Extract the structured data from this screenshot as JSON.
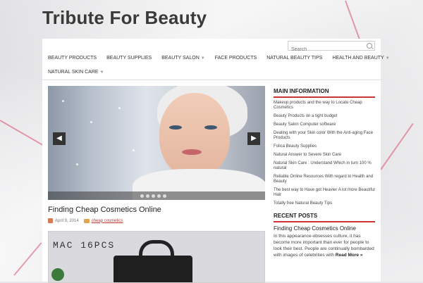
{
  "site": {
    "title": "Tribute For Beauty"
  },
  "search": {
    "placeholder": "Search"
  },
  "nav": {
    "row1": [
      {
        "label": "BEAUTY PRODUCTS",
        "has_submenu": false
      },
      {
        "label": "BEAUTY SUPPLIES",
        "has_submenu": false
      },
      {
        "label": "BEAUTY SALON",
        "has_submenu": true
      },
      {
        "label": "FACE PRODUCTS",
        "has_submenu": false
      },
      {
        "label": "NATURAL BEAUTY TIPS",
        "has_submenu": false
      },
      {
        "label": "HEALTH AND BEAUTY",
        "has_submenu": true
      }
    ],
    "row2": [
      {
        "label": "NATURAL SKIN CARE",
        "has_submenu": true
      }
    ]
  },
  "slider": {
    "dot_count": 5,
    "prev_icon": "arrow-left-icon",
    "next_icon": "arrow-right-icon"
  },
  "post": {
    "title": "Finding Cheap Cosmetics Online",
    "date": "April 9, 2014",
    "category": "cheap cosmetics",
    "image_text": "MAC 16PCS"
  },
  "sidebar": {
    "main_info_title": "MAIN INFORMATION",
    "links": [
      "Makeup products and the way to Locate Cheap Cosmetics",
      "Beauty Products on a tight budget",
      "Beauty Salon Computer software",
      "Dealing with your Skin color With the Anti-aging Face Products",
      "Folica Beauty Supplies",
      "Natural Answer to Severe Skin Care",
      "Natural Skin Care : Understand Which in turn 100 % natural",
      "Reliable Online Resources With regard to Health and Beauty",
      "The best way to Have got Heavier A lot more Beautiful Hair",
      "Totally free Natural Beauty Tips"
    ],
    "recent_title": "RECENT POSTS",
    "recent_post_title": "Finding Cheap Cosmetics Online",
    "recent_post_excerpt": "In this appearance-obsesses culture, it has become more important than ever for people to look their best. People are continually bombarded with images of celebrities with",
    "read_more": "Read More »"
  },
  "colors": {
    "accent": "#cc3333",
    "title": "#3a3a3a"
  }
}
